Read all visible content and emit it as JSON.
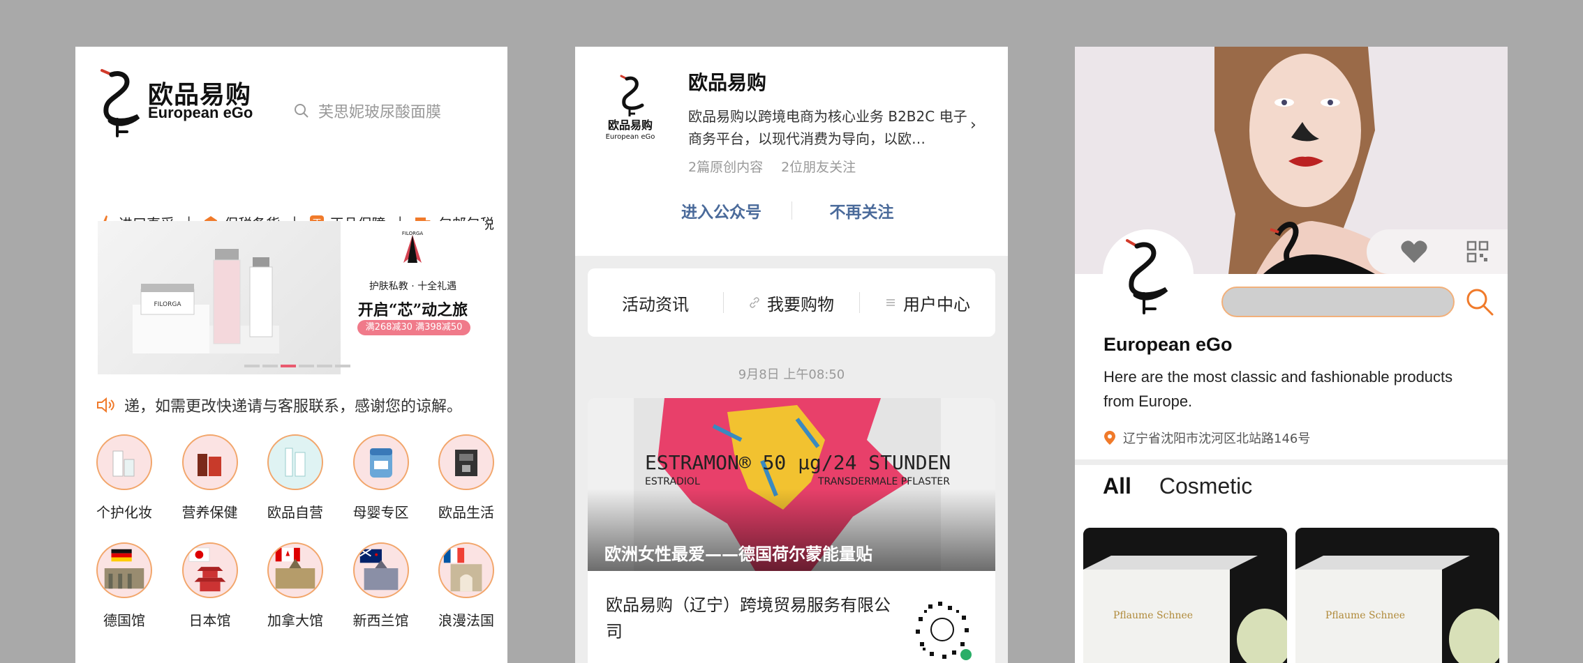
{
  "panel1": {
    "logo": {
      "cn": "欧品易购",
      "en": "European eGo"
    },
    "search": {
      "placeholder": "芙思妮玻尿酸面膜"
    },
    "features": [
      {
        "label": "进口直采",
        "icon": "plane-icon"
      },
      {
        "label": "保税备货",
        "icon": "warehouse-icon"
      },
      {
        "label": "正品保障",
        "icon": "genuine-badge-icon"
      },
      {
        "label": "包邮包税",
        "icon": "truck-icon"
      }
    ],
    "banner": {
      "brand": "FILORGA",
      "line1": "护肤私教 · 十全礼遇",
      "line2": "开启“芯”动之旅",
      "tag": "满268减30 满398减50"
    },
    "notice": "递，如需更改快递请与客服联系，感谢您的谅解。",
    "categories": [
      {
        "label": "个护化妆"
      },
      {
        "label": "营养保健"
      },
      {
        "label": "欧品自营"
      },
      {
        "label": "母婴专区"
      },
      {
        "label": "欧品生活"
      },
      {
        "label": "德国馆"
      },
      {
        "label": "日本馆"
      },
      {
        "label": "加拿大馆"
      },
      {
        "label": "新西兰馆"
      },
      {
        "label": "浪漫法国"
      }
    ],
    "accent": "#f07a2a"
  },
  "panel2": {
    "account_name": "欧品易购",
    "logo_cn": "欧品易购",
    "logo_en": "European eGo",
    "description": "欧品易购以跨境电商为核心业务 B2B2C 电子商务平台，以现代消费为导向，以欧…",
    "stats": {
      "original": "2篇原创内容",
      "friends": "2位朋友关注"
    },
    "actions": {
      "enter": "进入公众号",
      "unfollow": "不再关注"
    },
    "menu": [
      {
        "label": "活动资讯"
      },
      {
        "label": "我要购物"
      },
      {
        "label": "用户中心"
      }
    ],
    "timestamp": "9月8日 上午08:50",
    "card": {
      "product_text": "ESTRAMON® 50 µg/24 STUNDEN",
      "product_sub1": "ESTRADIOL",
      "product_sub2": "TRANSDERMALE PFLASTER",
      "caption": "欧洲女性最爱——德国荷尔蒙能量贴",
      "title": "欧品易购（辽宁）跨境贸易服务有限公司"
    },
    "link_color": "#4a6a9a"
  },
  "panel3": {
    "name": "European eGo",
    "description": "Here are the most classic and fashionable products from Europe.",
    "address": "辽宁省沈阳市沈河区北站路146号",
    "tabs": [
      {
        "label": "All"
      },
      {
        "label": "Cosmetic"
      }
    ],
    "product_label": "Pflaume Schnee"
  }
}
